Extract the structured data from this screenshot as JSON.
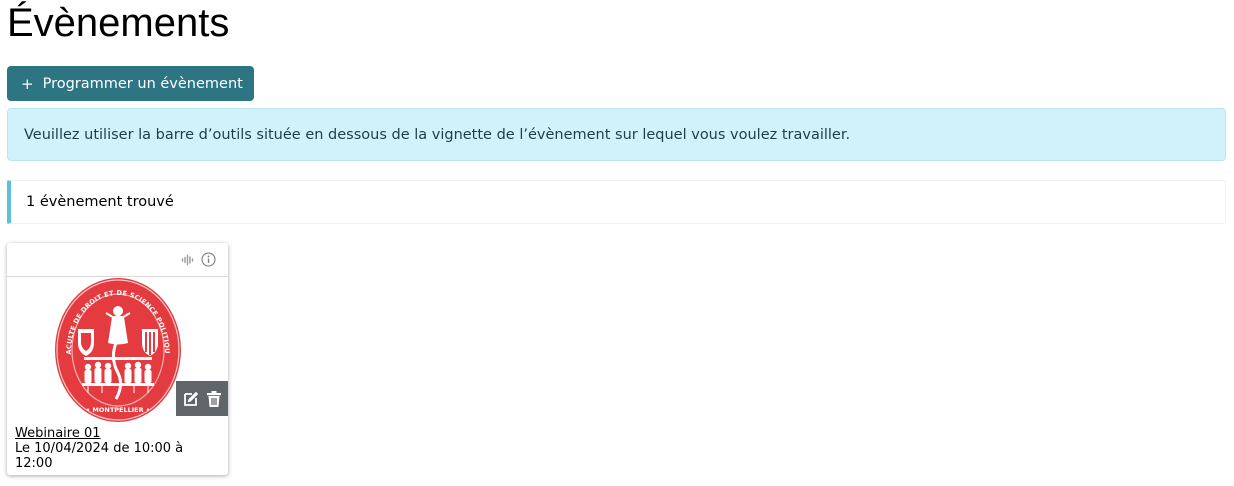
{
  "page": {
    "title": "Évènements"
  },
  "actions": {
    "add_label": "Programmer un évènement",
    "add_icon": "plus-icon"
  },
  "alert": {
    "text": "Veuillez utiliser la barre d’outils située en dessous de la vignette de l’évènement sur lequel vous voulez travailler."
  },
  "results": {
    "count_text": "1 évènement trouvé"
  },
  "events": [
    {
      "title": "Webinaire 01",
      "schedule": "Le 10/04/2024 de 10:00 à 12:00",
      "header_icons": [
        "audio-waveform-icon",
        "info-icon"
      ],
      "toolbar_icons": [
        "edit-icon",
        "trash-icon"
      ],
      "thumbnail": "faculty-seal-logo"
    }
  ],
  "colors": {
    "primary_button": "#2e7583",
    "alert_background": "#d1f2fa",
    "count_accent": "#5bc0de",
    "seal_red": "#e33b3f",
    "toolbar_background": "#5f6568"
  }
}
